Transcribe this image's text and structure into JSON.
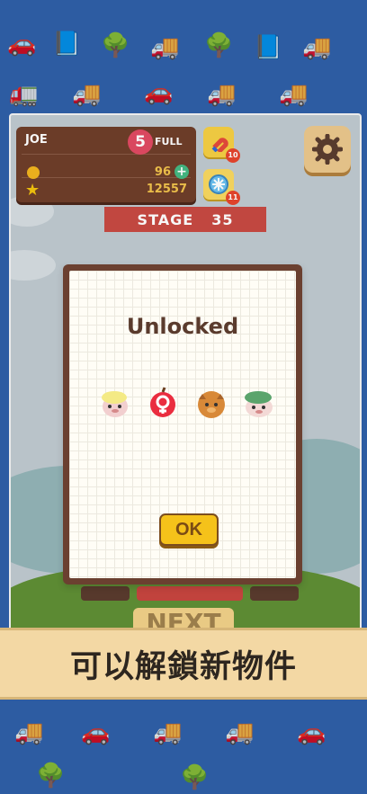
{
  "player": {
    "name": "JOE",
    "lives": "5",
    "lives_status": "FULL",
    "coins": "96",
    "stars": "12557"
  },
  "stage": {
    "label": "STAGE",
    "number": "35"
  },
  "powerups": [
    {
      "name": "magnet",
      "count": "10"
    },
    {
      "name": "freeze",
      "count": "11"
    }
  ],
  "modal": {
    "title": "Unlocked",
    "ok_label": "OK",
    "items": [
      {
        "icon": "blonde-hair-creature"
      },
      {
        "icon": "red-apple-female"
      },
      {
        "icon": "orange-fuzzy-creature"
      },
      {
        "icon": "green-hat-creature"
      }
    ]
  },
  "background": {
    "next_label": "NEXT"
  },
  "banner": {
    "text": "可以解鎖新物件"
  }
}
